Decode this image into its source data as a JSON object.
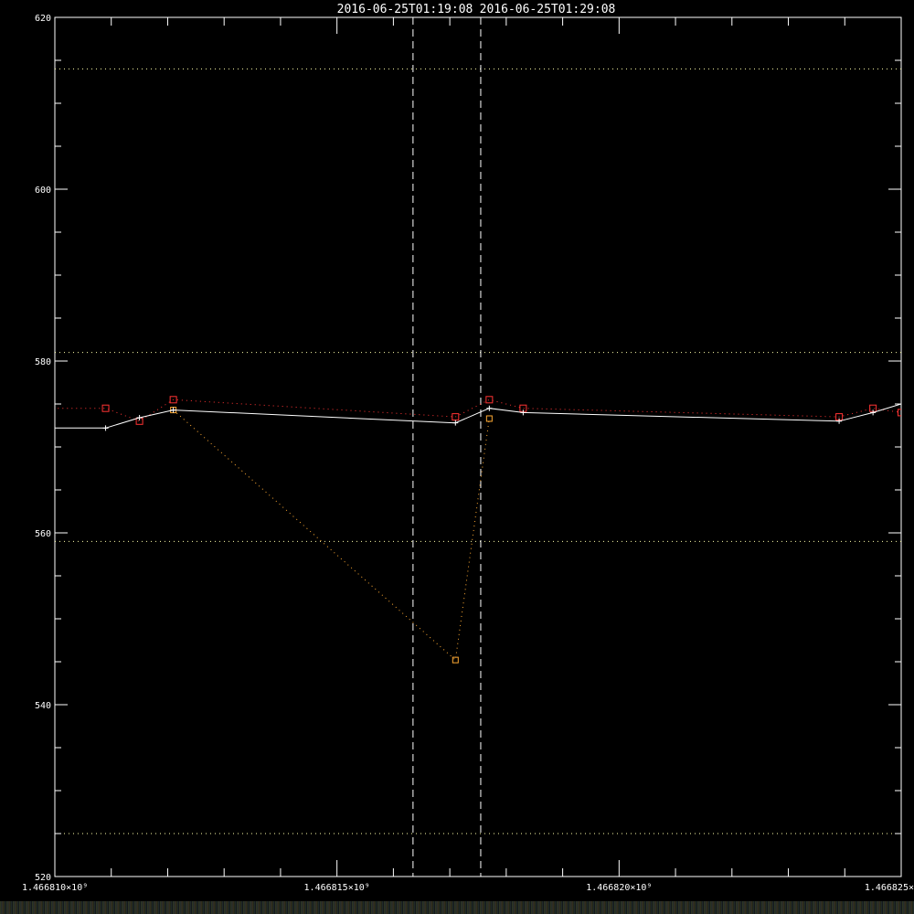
{
  "chart_data": {
    "type": "line",
    "title_left": "2016-06-25T01:19:08",
    "title_right": "2016-06-25T01:29:08",
    "xlabel": "",
    "ylabel": "",
    "xlim": [
      1466810000,
      1466825000
    ],
    "ylim": [
      520,
      620
    ],
    "x_ticks": [
      {
        "value": 1466810000,
        "label": "1.466810×10⁹"
      },
      {
        "value": 1466815000,
        "label": "1.466815×10⁹"
      },
      {
        "value": 1466820000,
        "label": "1.466820×10⁹"
      },
      {
        "value": 1466825000,
        "label": "1.466825×"
      }
    ],
    "y_ticks": [
      {
        "value": 520,
        "label": "520"
      },
      {
        "value": 540,
        "label": "540"
      },
      {
        "value": 560,
        "label": "560"
      },
      {
        "value": 580,
        "label": "580"
      },
      {
        "value": 600,
        "label": "600"
      },
      {
        "value": 620,
        "label": "620"
      }
    ],
    "event_lines_x": [
      1466816348,
      1466817548
    ],
    "reference_levels": [
      614,
      581,
      559,
      525
    ],
    "grid": false,
    "series": [
      {
        "style": "solid",
        "color": "#ffffff",
        "marker": "plus",
        "x": [
          1466809000,
          1466810900,
          1466811500,
          1466812100,
          1466817100,
          1466817700,
          1466818300,
          1466823900,
          1466824500,
          1466825000
        ],
        "y": [
          572.2,
          572.2,
          573.4,
          574.3,
          572.8,
          574.5,
          574.0,
          573.0,
          574.0,
          575.0
        ]
      },
      {
        "style": "dotted",
        "color": "#ff3333",
        "marker": "square",
        "x": [
          1466809000,
          1466810900,
          1466811500,
          1466812100,
          1466817100,
          1466817700,
          1466818300,
          1466823900,
          1466824500,
          1466825000
        ],
        "y": [
          574.5,
          574.5,
          573.0,
          575.5,
          573.5,
          575.5,
          574.5,
          573.5,
          574.5,
          574.0
        ]
      },
      {
        "style": "dotted",
        "color": "#ffaa33",
        "marker": "square-small",
        "x": [
          1466812100,
          1466817100,
          1466817700
        ],
        "y": [
          574.3,
          545.2,
          573.3
        ]
      }
    ]
  }
}
